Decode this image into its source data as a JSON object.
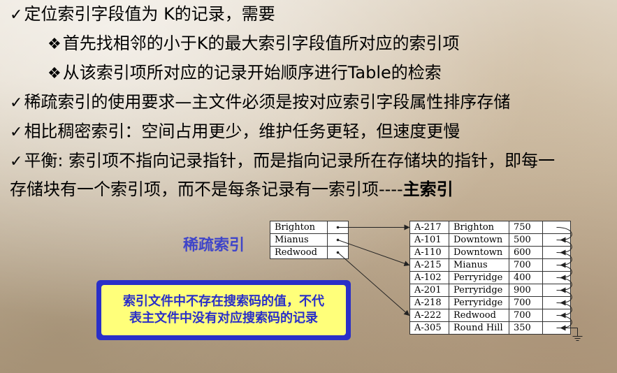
{
  "bullets": [
    {
      "mark": "✓",
      "text": "定位索引字段值为 K的记录，需要"
    },
    {
      "mark": "❖",
      "text": "首先找相邻的小于K的最大索引字段值所对应的索引项"
    },
    {
      "mark": "❖",
      "text": "从该索引项所对应的记录开始顺序进行Table的检索"
    },
    {
      "mark": "✓",
      "text": "稀疏索引的使用要求—主文件必须是按对应索引字段属性排序存储"
    },
    {
      "mark": "✓",
      "text": "相比稠密索引：空间占用更少，维护任务更轻，但速度更慢"
    },
    {
      "mark": "✓",
      "text": "平衡: 索引项不指向记录指针，而是指向记录所在存储块的指针，即每一"
    },
    {
      "mark": "",
      "text": "存储块有一个索引项，而不是每条记录有一索引项----",
      "bold_suffix": "主索引"
    }
  ],
  "diagram": {
    "label": "稀疏索引",
    "note_line1": "索引文件中不存在搜索码的值，不代",
    "note_line2": "表主文件中没有对应搜索码的记录",
    "index_entries": [
      "Brighton",
      "Mianus",
      "Redwood"
    ],
    "index_targets": [
      0,
      3,
      7
    ],
    "records": [
      [
        "A-217",
        "Brighton",
        "750"
      ],
      [
        "A-101",
        "Downtown",
        "500"
      ],
      [
        "A-110",
        "Downtown",
        "600"
      ],
      [
        "A-215",
        "Mianus",
        "700"
      ],
      [
        "A-102",
        "Perryridge",
        "400"
      ],
      [
        "A-201",
        "Perryridge",
        "900"
      ],
      [
        "A-218",
        "Perryridge",
        "700"
      ],
      [
        "A-222",
        "Redwood",
        "700"
      ],
      [
        "A-305",
        "Round Hill",
        "350"
      ]
    ]
  }
}
